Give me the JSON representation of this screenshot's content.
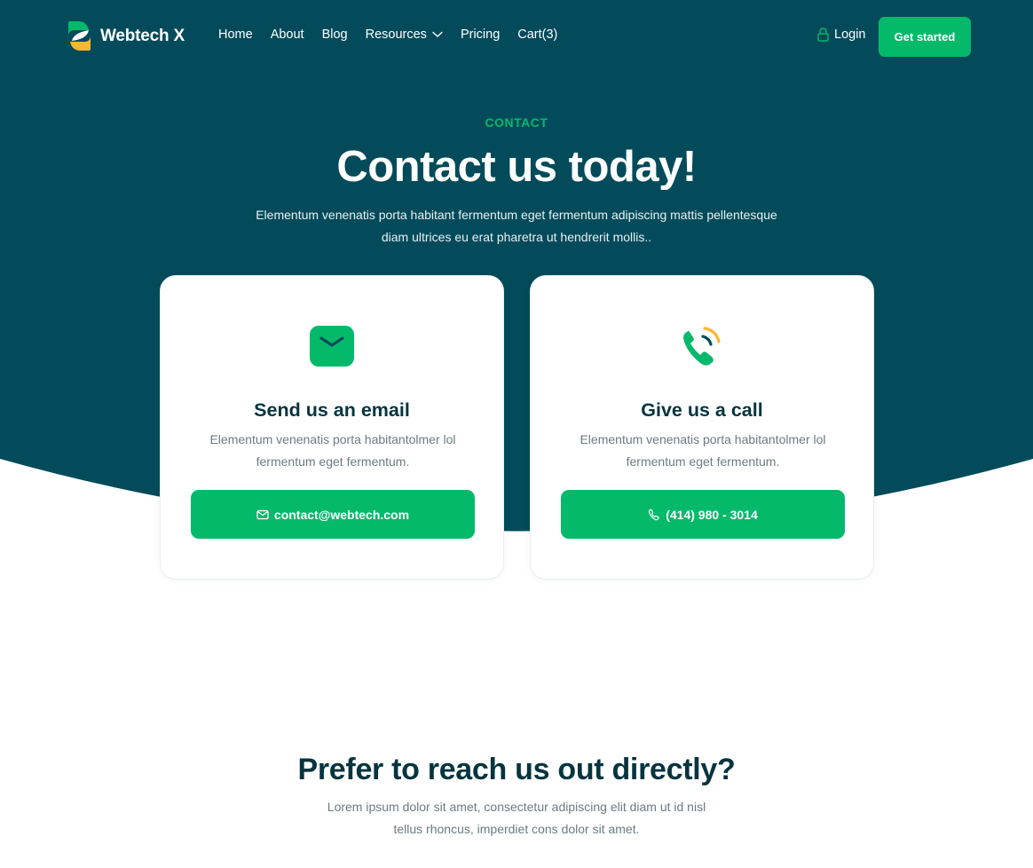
{
  "colors": {
    "primary_dark": "#034b5b",
    "accent_green": "#05b96b",
    "accent_yellow": "#fbb731",
    "heading": "#06343f",
    "body_text": "#6b7b80"
  },
  "nav": {
    "brand": "Webtech X",
    "logo_icon": "leaf-logo-icon",
    "links": [
      {
        "label": "Home"
      },
      {
        "label": "About"
      },
      {
        "label": "Blog"
      },
      {
        "label": "Resources",
        "icon": "chevron-down-icon"
      },
      {
        "label": "Pricing"
      },
      {
        "label": "Cart(3)"
      }
    ],
    "login": {
      "label": "Login",
      "icon": "lock-icon"
    },
    "cta": "Get started"
  },
  "hero": {
    "eyebrow": "CONTACT",
    "title": "Contact us today!",
    "subtitle": "Elementum venenatis porta habitant fermentum eget fermentum adipiscing mattis pellentesque diam ultrices eu erat pharetra ut hendrerit mollis.."
  },
  "cards": [
    {
      "icon": "envelope-icon",
      "title": "Send us an email",
      "text": "Elementum venenatis porta habitantolmer lol fermentum eget fermentum.",
      "button_icon": "mail-icon",
      "button_label": "contact@webtech.com"
    },
    {
      "icon": "phone-call-icon",
      "title": "Give us a call",
      "text": "Elementum venenatis porta habitantolmer lol fermentum eget fermentum.",
      "button_icon": "phone-icon",
      "button_label": "(414) 980 - 3014"
    }
  ],
  "direct": {
    "title": "Prefer to reach us out directly?",
    "subtitle": "Lorem ipsum dolor sit amet, consectetur adipiscing elit diam ut id nisl tellus rhoncus, imperdiet cons dolor sit amet."
  }
}
